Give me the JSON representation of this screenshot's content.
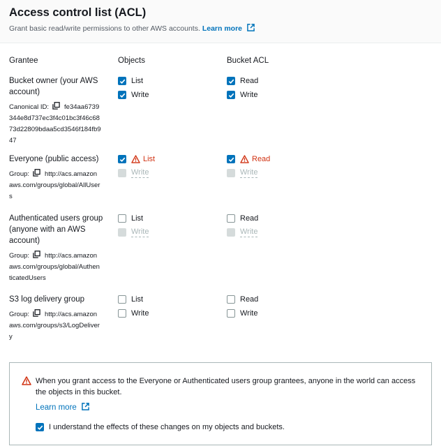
{
  "header": {
    "title": "Access control list (ACL)",
    "description": "Grant basic read/write permissions to other AWS accounts.",
    "learn_more": "Learn more"
  },
  "columns": {
    "grantee": "Grantee",
    "objects": "Objects",
    "bucket_acl": "Bucket ACL"
  },
  "grantees": [
    {
      "name": "Bucket owner (your AWS account)",
      "id_label": "Canonical ID:",
      "id_value": "fe34aa6739 344e8d737ec3f4c01bc3f46c68 73d22809bdaa5cd3546f184fb9 47",
      "objects": [
        {
          "label": "List",
          "state": "checked"
        },
        {
          "label": "Write",
          "state": "checked"
        }
      ],
      "bucket_acl": [
        {
          "label": "Read",
          "state": "checked"
        },
        {
          "label": "Write",
          "state": "checked"
        }
      ]
    },
    {
      "name": "Everyone (public access)",
      "id_label": "Group:",
      "id_value": "http://acs.amazon aws.com/groups/global/AllUser s",
      "objects": [
        {
          "label": "List",
          "state": "checked-warning"
        },
        {
          "label": "Write",
          "state": "disabled"
        }
      ],
      "bucket_acl": [
        {
          "label": "Read",
          "state": "checked-warning"
        },
        {
          "label": "Write",
          "state": "disabled"
        }
      ]
    },
    {
      "name": "Authenticated users group (anyone with an AWS account)",
      "id_label": "Group:",
      "id_value": "http://acs.amazon aws.com/groups/global/Authen ticatedUsers",
      "objects": [
        {
          "label": "List",
          "state": "unchecked"
        },
        {
          "label": "Write",
          "state": "disabled"
        }
      ],
      "bucket_acl": [
        {
          "label": "Read",
          "state": "unchecked"
        },
        {
          "label": "Write",
          "state": "disabled"
        }
      ]
    },
    {
      "name": "S3 log delivery group",
      "id_label": "Group:",
      "id_value": "http://acs.amazon aws.com/groups/s3/LogDeliver y",
      "objects": [
        {
          "label": "List",
          "state": "unchecked"
        },
        {
          "label": "Write",
          "state": "unchecked"
        }
      ],
      "bucket_acl": [
        {
          "label": "Read",
          "state": "unchecked"
        },
        {
          "label": "Write",
          "state": "unchecked"
        }
      ]
    }
  ],
  "alert": {
    "message": "When you grant access to the Everyone or Authenticated users group grantees, anyone in the world can access the objects in this bucket.",
    "learn_more": "Learn more",
    "acknowledge": "I understand the effects of these changes on my objects and buckets.",
    "acknowledge_checked": true
  },
  "colors": {
    "accent": "#0073bb",
    "warning": "#d13212",
    "disabled": "#aab7b8"
  },
  "icons": {
    "external": "external-link-icon",
    "copy": "copy-icon",
    "warning": "warning-icon",
    "check": "checkmark-icon"
  }
}
